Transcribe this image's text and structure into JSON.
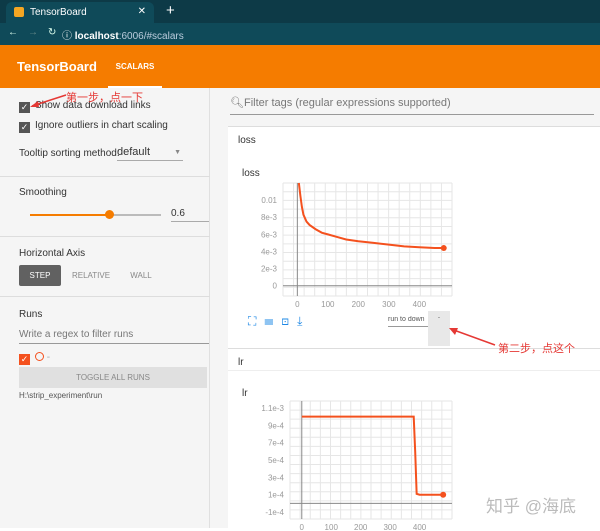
{
  "browser": {
    "tab_title": "TensorBoard",
    "url_host": "localhost",
    "url_rest": ":6006/#scalars"
  },
  "header": {
    "brand": "TensorBoard",
    "tab": "SCALARS"
  },
  "sidebar": {
    "show_download": "Show data download links",
    "ignore_outliers": "Ignore outliers in chart scaling",
    "tooltip_label": "Tooltip sorting method:",
    "tooltip_value": "default",
    "smoothing_label": "Smoothing",
    "smoothing_value": "0.6",
    "smoothing_fraction": 0.6,
    "haxis_label": "Horizontal Axis",
    "haxis_options": [
      "STEP",
      "RELATIVE",
      "WALL"
    ],
    "runs_label": "Runs",
    "runs_placeholder": "Write a regex to filter runs",
    "run_name": "-",
    "toggle_all": "TOGGLE ALL RUNS",
    "logdir": "H:\\strip_experiment\\run"
  },
  "main": {
    "search_placeholder": "Filter tags (regular expressions supported)",
    "run_download": "run to down",
    "dot": "."
  },
  "annotations": {
    "step1": "第一步，点一下",
    "step2": "第二步，点这个",
    "watermark": "知乎 @海底"
  },
  "chart_data": [
    {
      "type": "line",
      "group": "loss",
      "title": "loss",
      "color": "#f4511e",
      "xlim": [
        -47,
        507
      ],
      "ylim": [
        -0.0012,
        0.012
      ],
      "xticks": [
        0,
        100,
        200,
        300,
        400
      ],
      "yticks": [
        0,
        0.002,
        0.004,
        0.006,
        0.008,
        0.01
      ],
      "ytick_labels": [
        "0",
        "2e-3",
        "4e-3",
        "6e-3",
        "8e-3",
        "0.01"
      ],
      "x": [
        5,
        10,
        15,
        20,
        30,
        40,
        60,
        80,
        100,
        130,
        160,
        200,
        250,
        300,
        350,
        400,
        450,
        480
      ],
      "y": [
        0.012,
        0.0105,
        0.0092,
        0.0083,
        0.0075,
        0.0071,
        0.0066,
        0.0062,
        0.006,
        0.0057,
        0.0054,
        0.0052,
        0.005,
        0.0048,
        0.0046,
        0.0045,
        0.0044,
        0.0044
      ]
    },
    {
      "type": "line",
      "group": "lr",
      "title": "lr",
      "color": "#f4511e",
      "xlim": [
        -40,
        510
      ],
      "ylim": [
        -0.00018,
        0.00118
      ],
      "xticks": [
        0,
        100,
        200,
        300,
        400
      ],
      "yticks": [
        0.0011,
        0.0009,
        0.0007,
        0.0005,
        0.0003,
        0.0001,
        -0.0001
      ],
      "ytick_labels": [
        "1.1e-3",
        "9e-4",
        "7e-4",
        "5e-4",
        "3e-4",
        "1e-4",
        "-1e-4"
      ],
      "x": [
        0,
        380,
        385,
        390,
        400,
        480
      ],
      "y": [
        0.001,
        0.001,
        0.0006,
        0.00011,
        0.0001,
        0.0001
      ]
    }
  ]
}
